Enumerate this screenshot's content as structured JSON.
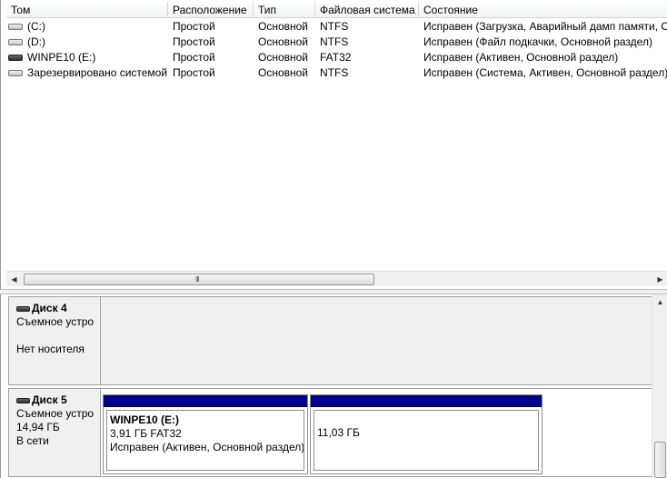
{
  "volume_list": {
    "columns": [
      "Том",
      "Расположение",
      "Тип",
      "Файловая система",
      "Состояние"
    ],
    "rows": [
      {
        "volume": "(C:)",
        "icon": "hard-drive-icon",
        "location": "Простой",
        "type": "Основной",
        "fs": "NTFS",
        "state": "Исправен (Загрузка, Аварийный дамп памяти, О"
      },
      {
        "volume": "(D:)",
        "icon": "hard-drive-icon",
        "location": "Простой",
        "type": "Основной",
        "fs": "NTFS",
        "state": "Исправен (Файл подкачки, Основной раздел)"
      },
      {
        "volume": "WINPE10 (E:)",
        "icon": "usb-drive-icon",
        "location": "Простой",
        "type": "Основной",
        "fs": "FAT32",
        "state": "Исправен (Активен, Основной раздел)"
      },
      {
        "volume": "Зарезервировано системой",
        "icon": "hard-drive-icon",
        "location": "Простой",
        "type": "Основной",
        "fs": "NTFS",
        "state": "Исправен (Система, Активен, Основной раздел)"
      }
    ]
  },
  "hscroll": {
    "left_arrow": "◀",
    "right_arrow": "▶",
    "grip": "III"
  },
  "disks": [
    {
      "title": "Диск 4",
      "kind": "Съемное устро",
      "size": "",
      "status": "Нет носителя"
    },
    {
      "title": "Диск 5",
      "kind": "Съемное устро",
      "size": "14,94 ГБ",
      "status": "В сети"
    }
  ],
  "partitions": [
    {
      "name": "WINPE10  (E:)",
      "size_fs": "3,91 ГБ FAT32",
      "state": "Исправен (Активен, Основной раздел)"
    },
    {
      "size": "11,03 ГБ"
    }
  ],
  "vscroll": {
    "up_arrow": "▲"
  },
  "colors": {
    "partition_bar": "#00008c",
    "pane_background": "#f0f0f0"
  }
}
